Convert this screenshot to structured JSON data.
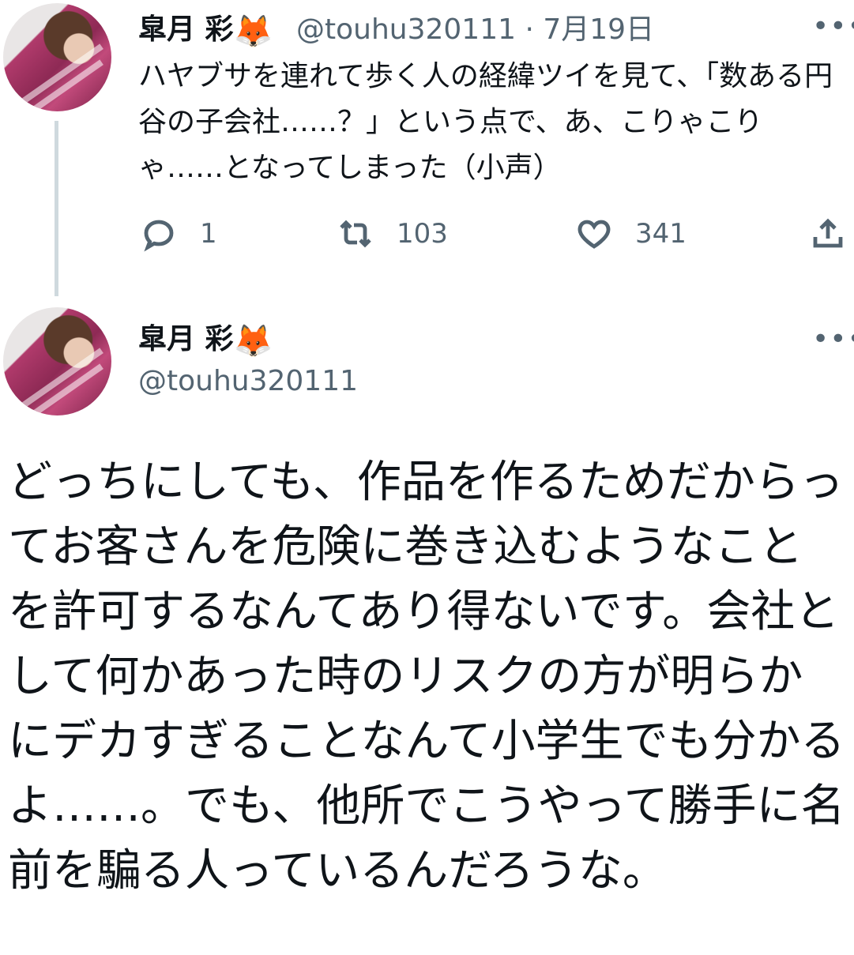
{
  "reply_tweet": {
    "author_name": "皐月 彩",
    "author_emoji": "🦊",
    "handle": "@touhu320111",
    "date": "· 7月19日",
    "more_label": "•••",
    "text": "ハヤブサを連れて歩く人の経緯ツイを見て、「数ある円谷の子会社……？」という点で、あ、こりゃこりゃ……となってしまった（小声）",
    "actions": {
      "replies": "1",
      "retweets": "103",
      "likes": "341"
    }
  },
  "main_tweet": {
    "author_name": "皐月 彩",
    "author_emoji": "🦊",
    "handle": "@touhu320111",
    "more_label": "•••",
    "text": "どっちにしても、作品を作るためだからってお客さんを危険に巻き込むようなことを許可するなんてあり得ないです。会社として何かあった時のリスクの方が明らかにデカすぎることなんて小学生でも分かるよ……。でも、他所でこうやって勝手に名前を騙る人っているんだろうな。"
  }
}
